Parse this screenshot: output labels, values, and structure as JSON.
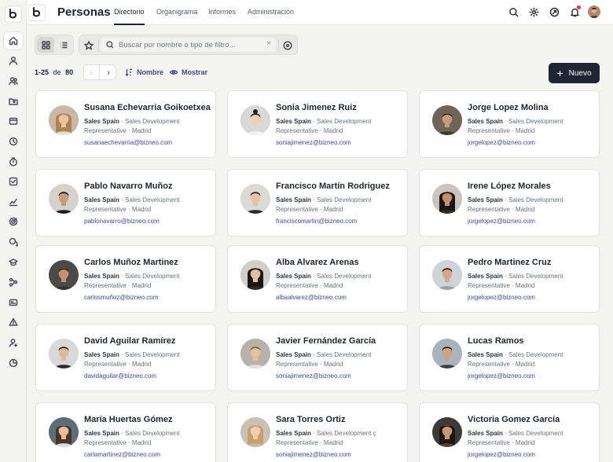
{
  "header": {
    "title": "Personas",
    "tabs": [
      {
        "label": "Directorio",
        "active": true
      },
      {
        "label": "Organigrama",
        "active": false
      },
      {
        "label": "Informes",
        "active": false
      },
      {
        "label": "Administración",
        "active": false
      }
    ],
    "icons": [
      "search-icon",
      "gear-icon",
      "rocket-icon",
      "bell-icon"
    ]
  },
  "rail": {
    "icons": [
      "home-icon",
      "user-icon",
      "users-icon",
      "folder-user-icon",
      "wallet-icon",
      "clock-icon",
      "stopwatch-icon",
      "check-square-icon",
      "chart-line-icon",
      "target-icon",
      "chat-icon",
      "graduation-cap-icon",
      "workflow-icon",
      "id-card-icon",
      "alert-triangle-icon",
      "user-settings-icon",
      "pie-chart-icon"
    ]
  },
  "toolbar": {
    "search_placeholder": "Buscar por nombre o tipo de filtro...",
    "clear_label": "×"
  },
  "pagination": {
    "range": "1-25",
    "of_label": "de",
    "total": "80",
    "prev_label": "‹",
    "next_label": "›"
  },
  "controls": {
    "sort_label": "Nombre",
    "show_label": "Mostrar",
    "new_label": "Nuevo"
  },
  "colors": {
    "accent": "#3f4a8f",
    "primary_button": "#1f2533",
    "notification": "#e0343a"
  },
  "people": [
    {
      "name": "Susana Echevarria Goikoetxea",
      "team": "Sales Spain",
      "role": "· Sales Development Representative · Madrid",
      "email": "susanaechevarria@bizneo.com"
    },
    {
      "name": "Sonia Jimenez Ruiz",
      "team": "Sales Spain",
      "role": "· Sales Development Representative · Madrid",
      "email": "soniajimenez@bizneo.com"
    },
    {
      "name": "Jorge Lopez Molina",
      "team": "Sales Spain",
      "role": "· Sales Development Representative · Madrid",
      "email": "jorgelopez@bizneo.com"
    },
    {
      "name": "Pablo Navarro Muñoz",
      "team": "Sales Spain",
      "role": "· Sales Development Representative · Madrid",
      "email": "pablonavarro@bizneo.com"
    },
    {
      "name": "Francisco Martín Rodriguez",
      "team": "Sales Spain",
      "role": "· Sales Development Representative · Madrid",
      "email": "franciscomartin@bizneo.com"
    },
    {
      "name": "Irene López Morales",
      "team": "Sales Spain",
      "role": "· Sales Development Representative · Madrid",
      "email": "jorgelopez@bizneo.com"
    },
    {
      "name": "Carlos Muñoz Martinez",
      "team": "Sales Spain",
      "role": "· Sales Development Representative · Madrid",
      "email": "carlosmuñoz@bizneo.com"
    },
    {
      "name": "Alba Alvarez Arenas",
      "team": "Sales Spain",
      "role": "· Sales Development Representative · Madrid",
      "email": "albaalvarez@bizneo.com"
    },
    {
      "name": "Pedro Martinez Cruz",
      "team": "Sales Spain",
      "role": "· Sales Development Representative · Madrid",
      "email": "jorgelopez@bizneo.com"
    },
    {
      "name": "David Aguilar Ramírez",
      "team": "Sales Spain",
      "role": "· Sales Development Representative · Madrid",
      "email": "davidaguilar@bizneo.com"
    },
    {
      "name": "Javier Fernández García",
      "team": "Sales Spain",
      "role": "· Sales Development Representative · Madrid",
      "email": "soniajimenez@bizneo.com"
    },
    {
      "name": "Lucas Ramos",
      "team": "Sales Spain",
      "role": "· Sales Development Representative · Madrid",
      "email": "jorgelopez@bizneo.com"
    },
    {
      "name": "María Huertas Gómez",
      "team": "Sales Spain",
      "role": "· Sales Development Representative · Madrid",
      "email": "carlamartinez@bizneo.com"
    },
    {
      "name": "Sara Torres Ortiz",
      "team": "Sales Spain",
      "role": "· Sales Development ç Representative · Madrid",
      "email": "soniajimenez@bizneo.com"
    },
    {
      "name": "Victoria Gomez García",
      "team": "Sales Spain",
      "role": "· Sales Development Representative · Madrid",
      "email": "jorgelopez@bizneo.com"
    }
  ]
}
